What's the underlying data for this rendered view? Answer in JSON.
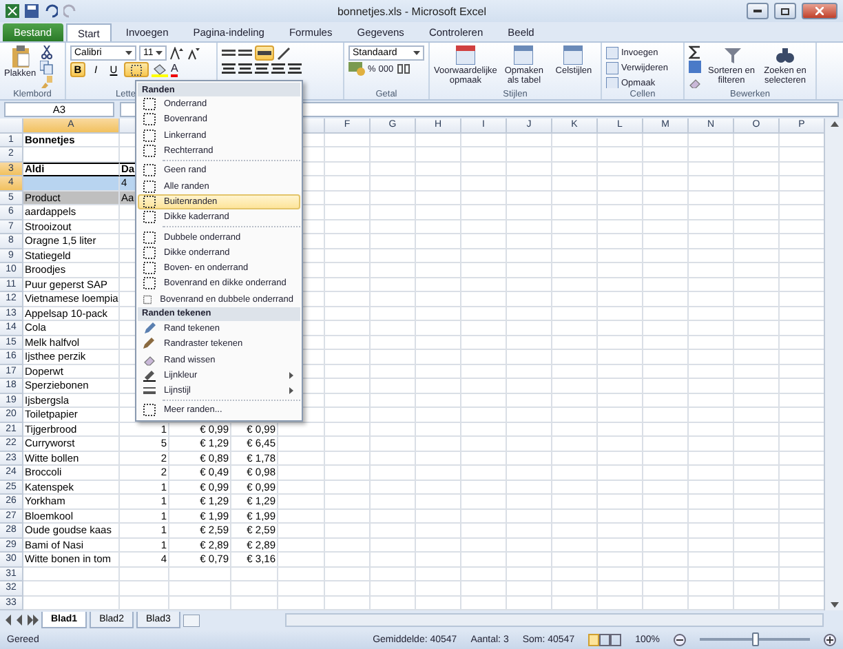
{
  "window": {
    "title": "bonnetjes.xls - Microsoft Excel"
  },
  "tabs": [
    {
      "label": "Bestand",
      "kind": "file",
      "selected": false
    },
    {
      "label": "Start",
      "kind": "tab",
      "selected": true
    },
    {
      "label": "Invoegen",
      "kind": "tab",
      "selected": false
    },
    {
      "label": "Pagina-indeling",
      "kind": "tab",
      "selected": false
    },
    {
      "label": "Formules",
      "kind": "tab",
      "selected": false
    },
    {
      "label": "Gegevens",
      "kind": "tab",
      "selected": false
    },
    {
      "label": "Controleren",
      "kind": "tab",
      "selected": false
    },
    {
      "label": "Beeld",
      "kind": "tab",
      "selected": false
    }
  ],
  "ribbon": {
    "groups": [
      {
        "kind": "clipboard",
        "label": "Klembord",
        "paste": "Plakken"
      },
      {
        "kind": "font",
        "label": "Lette",
        "font": "Calibri",
        "size": "11",
        "format_buttons": [
          {
            "label": "B",
            "selected": true
          },
          {
            "label": "I",
            "selected": false
          },
          {
            "label": "U",
            "selected": false
          }
        ],
        "font_color": "A",
        "borders_open": true
      },
      {
        "kind": "alignment"
      },
      {
        "kind": "number",
        "label": "Getal",
        "format": "Standaard",
        "percent": "%",
        "thousands": "000"
      },
      {
        "kind": "styles",
        "label": "Stijlen",
        "buttons": [
          "Voorwaardelijke opmaak",
          "Opmaken als tabel",
          "Celstijlen"
        ]
      },
      {
        "kind": "cells",
        "label": "Cellen",
        "buttons": [
          "Invoegen",
          "Verwijderen",
          "Opmaak"
        ]
      },
      {
        "kind": "editing",
        "label": "Bewerken",
        "buttons": [
          "Sorteren en filteren",
          "Zoeken en selecteren"
        ]
      }
    ]
  },
  "name_box": "A3",
  "columns": [
    {
      "label": "A",
      "selected": true
    },
    {
      "selected": false
    },
    {},
    {},
    {
      "selected": false
    },
    {
      "label": "F",
      "selected": false
    },
    {
      "label": "G",
      "selected": false
    },
    {
      "label": "H",
      "selected": false
    },
    {
      "label": "I",
      "selected": false
    },
    {
      "label": "J",
      "selected": false
    },
    {
      "label": "K",
      "selected": false
    },
    {
      "label": "L",
      "selected": false
    },
    {
      "label": "M",
      "selected": false
    },
    {
      "label": "N",
      "selected": false
    },
    {
      "label": "O",
      "selected": false
    },
    {
      "label": "P",
      "selected": false
    }
  ],
  "rows": [
    {
      "n": "1",
      "kind": "title",
      "selected": false,
      "cells": [
        "Bonnetjes"
      ]
    },
    {
      "n": "2",
      "kind": "item",
      "selected": false,
      "cells": []
    },
    {
      "n": "3",
      "kind": "store",
      "selected": true,
      "cells": [
        "Aldi",
        "Da"
      ]
    },
    {
      "n": "4",
      "kind": "band",
      "selected": true,
      "cells": [
        null,
        "4"
      ]
    },
    {
      "n": "5",
      "kind": "head",
      "selected": false,
      "cells": [
        "Product",
        "Aa"
      ]
    },
    {
      "n": "6",
      "kind": "item",
      "selected": false,
      "cells": [
        "aardappels"
      ]
    },
    {
      "n": "7",
      "kind": "item",
      "selected": false,
      "cells": [
        "Strooizout"
      ]
    },
    {
      "n": "8",
      "kind": "item",
      "selected": false,
      "cells": [
        "Oragne 1,5 liter"
      ]
    },
    {
      "n": "9",
      "kind": "item",
      "selected": false,
      "cells": [
        "Statiegeld"
      ]
    },
    {
      "n": "10",
      "kind": "item",
      "selected": false,
      "cells": [
        "Broodjes"
      ]
    },
    {
      "n": "11",
      "kind": "item",
      "selected": false,
      "cells": [
        "Puur geperst SAP"
      ]
    },
    {
      "n": "12",
      "kind": "item",
      "selected": false,
      "cells": [
        "Vietnamese loempia"
      ]
    },
    {
      "n": "13",
      "kind": "item",
      "selected": false,
      "cells": [
        "Appelsap 10-pack"
      ]
    },
    {
      "n": "14",
      "kind": "item",
      "selected": false,
      "cells": [
        "Cola"
      ]
    },
    {
      "n": "15",
      "kind": "item",
      "selected": false,
      "cells": [
        "Melk halfvol"
      ]
    },
    {
      "n": "16",
      "kind": "item",
      "selected": false,
      "cells": [
        "Ijsthee perzik"
      ]
    },
    {
      "n": "17",
      "kind": "item",
      "selected": false,
      "cells": [
        "Doperwt"
      ]
    },
    {
      "n": "18",
      "kind": "item",
      "selected": false,
      "cells": [
        "Sperziebonen"
      ]
    },
    {
      "n": "19",
      "kind": "item",
      "selected": false,
      "cells": [
        "Ijsbergsla"
      ]
    },
    {
      "n": "20",
      "kind": "item",
      "selected": false,
      "cells": [
        "Toiletpapier"
      ]
    },
    {
      "n": "21",
      "kind": "item",
      "selected": false,
      "cells": [
        "Tijgerbrood",
        "1",
        "€ 0,99",
        "€ 0,99"
      ]
    },
    {
      "n": "22",
      "kind": "item",
      "selected": false,
      "cells": [
        "Curryworst",
        "5",
        "€ 1,29",
        "€ 6,45"
      ]
    },
    {
      "n": "23",
      "kind": "item",
      "selected": false,
      "cells": [
        "Witte bollen",
        "2",
        "€ 0,89",
        "€ 1,78"
      ]
    },
    {
      "n": "24",
      "kind": "item",
      "selected": false,
      "cells": [
        "Broccoli",
        "2",
        "€ 0,49",
        "€ 0,98"
      ]
    },
    {
      "n": "25",
      "kind": "item",
      "selected": false,
      "cells": [
        "Katenspek",
        "1",
        "€ 0,99",
        "€ 0,99"
      ]
    },
    {
      "n": "26",
      "kind": "item",
      "selected": false,
      "cells": [
        "Yorkham",
        "1",
        "€ 1,29",
        "€ 1,29"
      ]
    },
    {
      "n": "27",
      "kind": "item",
      "selected": false,
      "cells": [
        "Bloemkool",
        "1",
        "€ 1,99",
        "€ 1,99"
      ]
    },
    {
      "n": "28",
      "kind": "item",
      "selected": false,
      "cells": [
        "Oude goudse kaas",
        "1",
        "€ 2,59",
        "€ 2,59"
      ]
    },
    {
      "n": "29",
      "kind": "item",
      "selected": false,
      "cells": [
        "Bami of Nasi",
        "1",
        "€ 2,89",
        "€ 2,89"
      ]
    },
    {
      "n": "30",
      "kind": "item",
      "selected": false,
      "cells": [
        "Witte bonen in tom",
        "4",
        "€ 0,79",
        "€ 3,16"
      ]
    },
    {
      "n": "31",
      "kind": "item",
      "selected": false,
      "cells": []
    },
    {
      "n": "32",
      "kind": "item",
      "selected": false,
      "cells": []
    },
    {
      "n": "33",
      "kind": "item",
      "selected": false,
      "cells": []
    }
  ],
  "border_menu": {
    "items": [
      {
        "kind": "section",
        "label": "Randen"
      },
      {
        "kind": "border",
        "label": "Onderrand",
        "selected": false
      },
      {
        "kind": "border",
        "label": "Bovenrand",
        "selected": false
      },
      {
        "kind": "border",
        "label": "Linkerrand",
        "selected": false
      },
      {
        "kind": "border",
        "label": "Rechterrand",
        "selected": false
      },
      {
        "kind": "divider"
      },
      {
        "kind": "border",
        "label": "Geen rand",
        "selected": false
      },
      {
        "kind": "border",
        "label": "Alle randen",
        "selected": false
      },
      {
        "kind": "border",
        "label": "Buitenranden",
        "selected": true
      },
      {
        "kind": "border",
        "label": "Dikke kaderrand",
        "selected": false
      },
      {
        "kind": "divider"
      },
      {
        "kind": "border",
        "label": "Dubbele onderrand",
        "selected": false
      },
      {
        "kind": "border",
        "label": "Dikke onderrand",
        "selected": false
      },
      {
        "kind": "border",
        "label": "Boven- en onderrand",
        "selected": false
      },
      {
        "kind": "border",
        "label": "Bovenrand en dikke onderrand",
        "selected": false
      },
      {
        "kind": "border",
        "label": "Bovenrand en dubbele onderrand",
        "selected": false
      },
      {
        "kind": "section",
        "label": "Randen tekenen"
      },
      {
        "kind": "pen",
        "label": "Rand tekenen",
        "selected": false
      },
      {
        "kind": "grid-pen",
        "label": "Randraster tekenen",
        "selected": false
      },
      {
        "kind": "eraser",
        "label": "Rand wissen",
        "selected": false
      },
      {
        "kind": "line-color",
        "label": "Lijnkleur",
        "selected": false,
        "submenu": true
      },
      {
        "kind": "line-style",
        "label": "Lijnstijl",
        "selected": false,
        "submenu": true
      },
      {
        "kind": "divider"
      },
      {
        "kind": "border",
        "label": "Meer randen...",
        "selected": false
      }
    ]
  },
  "sheets": [
    {
      "label": "Blad1",
      "selected": true
    },
    {
      "label": "Blad2",
      "selected": false
    },
    {
      "label": "Blad3",
      "selected": false
    }
  ],
  "status_bar": {
    "state": "Gereed",
    "stats": [
      "Gemiddelde: 40547",
      "Aantal: 3",
      "Som: 40547"
    ],
    "zoom": "100%",
    "zoom_slider": {
      "level": 0.5
    }
  }
}
